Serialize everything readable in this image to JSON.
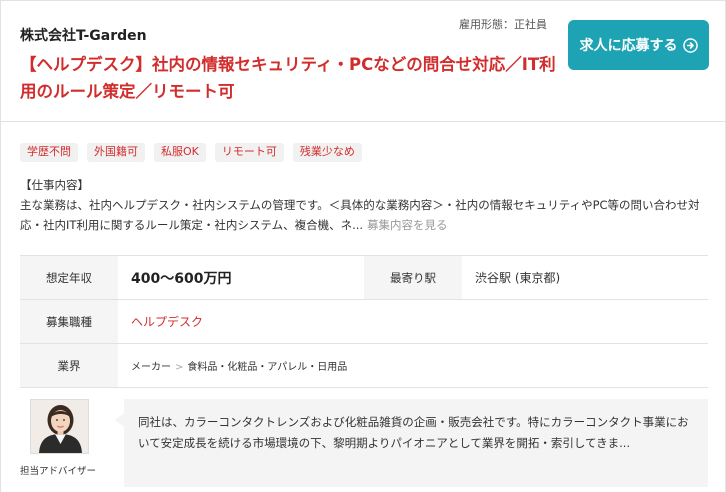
{
  "job": {
    "company": "株式会社T-Garden",
    "employment_type": "雇用形態：正社員",
    "title": "【ヘルプデスク】社内の情報セキュリティ・PCなどの問合せ対応／IT利用のルール策定／リモート可",
    "apply_label": "求人に応募する",
    "tags": [
      "学歴不問",
      "外国籍可",
      "私服OK",
      "リモート可",
      "残業少なめ"
    ],
    "description_heading": "【仕事内容】",
    "description": "主な業務は、社内ヘルプデスク・社内システムの管理です。＜具体的な業務内容＞・社内の情報セキュリティやPC等の問い合わせ対応・社内IT利用に関するルール策定・社内システム、複合機、ネ...",
    "description_more": "募集内容を見る",
    "info": {
      "salary_label": "想定年収",
      "salary_value": "400〜600万円",
      "station_label": "最寄り駅",
      "station_value": "渋谷駅 (東京都)",
      "position_label": "募集職種",
      "position_value": "ヘルプデスク",
      "industry_label": "業界",
      "industry_parent": "メーカー",
      "industry_arrow": ">",
      "industry_child": "食料品・化粧品・アパレル・日用品"
    },
    "advisor": {
      "label": "担当アドバイザー",
      "comment": "同社は、カラーコンタクトレンズおよび化粧品雑貨の企画・販売会社です。特にカラーコンタクト事業において安定成長を続ける市場環境の下、黎明期よりパイオニアとして業界を開拓・索引してきま..."
    }
  },
  "colors": {
    "accent_red": "#d22d2d",
    "button_teal": "#1da3b3",
    "label_bg": "#f5f5f5"
  },
  "icons": {
    "apply": "circle-arrow-right-icon"
  }
}
